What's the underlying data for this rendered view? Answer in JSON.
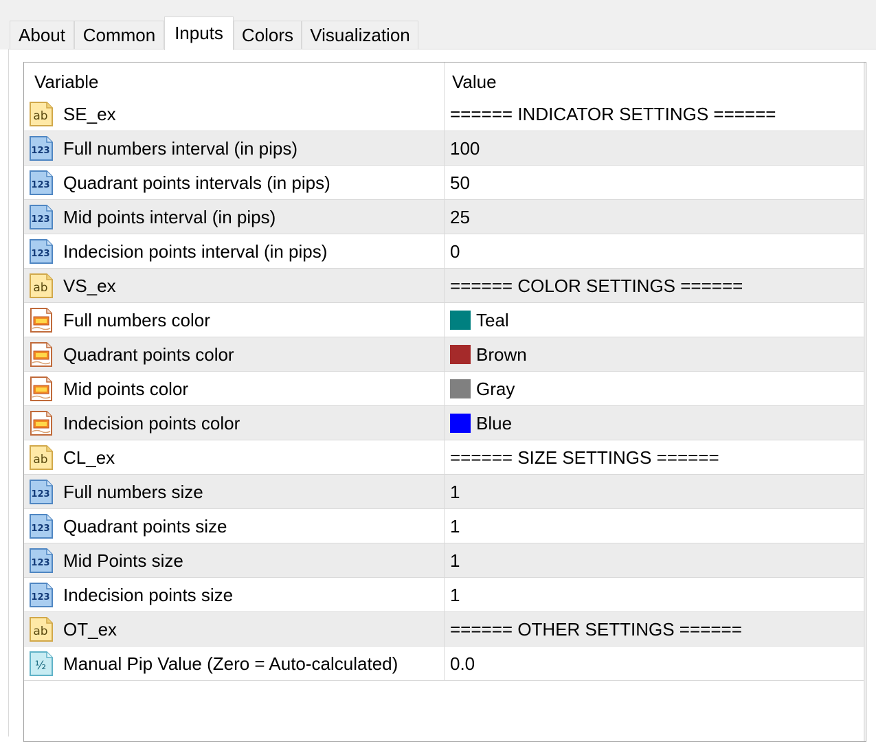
{
  "tabs": [
    {
      "label": "About",
      "active": false
    },
    {
      "label": "Common",
      "active": false
    },
    {
      "label": "Inputs",
      "active": true
    },
    {
      "label": "Colors",
      "active": false
    },
    {
      "label": "Visualization",
      "active": false
    }
  ],
  "table": {
    "columns": [
      "Variable",
      "Value"
    ],
    "rows": [
      {
        "icon": "string-type-icon",
        "variable": "SE_ex",
        "value": "====== INDICATOR SETTINGS ======"
      },
      {
        "icon": "integer-type-icon",
        "variable": "Full numbers interval (in pips)",
        "value": "100"
      },
      {
        "icon": "integer-type-icon",
        "variable": "Quadrant points intervals (in pips)",
        "value": "50"
      },
      {
        "icon": "integer-type-icon",
        "variable": "Mid points interval (in pips)",
        "value": "25"
      },
      {
        "icon": "integer-type-icon",
        "variable": "Indecision points interval (in pips)",
        "value": "0"
      },
      {
        "icon": "string-type-icon",
        "variable": "VS_ex",
        "value": "====== COLOR SETTINGS ======"
      },
      {
        "icon": "color-type-icon",
        "variable": "Full numbers color",
        "value": "Teal",
        "swatch": "#008080"
      },
      {
        "icon": "color-type-icon",
        "variable": "Quadrant points color",
        "value": "Brown",
        "swatch": "#a52a2a"
      },
      {
        "icon": "color-type-icon",
        "variable": "Mid points color",
        "value": "Gray",
        "swatch": "#808080"
      },
      {
        "icon": "color-type-icon",
        "variable": "Indecision points color",
        "value": "Blue",
        "swatch": "#0000ff"
      },
      {
        "icon": "string-type-icon",
        "variable": "CL_ex",
        "value": "====== SIZE SETTINGS ======"
      },
      {
        "icon": "integer-type-icon",
        "variable": "Full numbers size",
        "value": "1"
      },
      {
        "icon": "integer-type-icon",
        "variable": "Quadrant points size",
        "value": "1"
      },
      {
        "icon": "integer-type-icon",
        "variable": "Mid Points size",
        "value": "1"
      },
      {
        "icon": "integer-type-icon",
        "variable": "Indecision points size",
        "value": "1"
      },
      {
        "icon": "string-type-icon",
        "variable": "OT_ex",
        "value": "====== OTHER SETTINGS ======"
      },
      {
        "icon": "double-type-icon",
        "variable": "Manual Pip Value (Zero = Auto-calculated)",
        "value": "0.0"
      }
    ]
  },
  "icon_glyphs": {
    "string-type-icon": "ab",
    "integer-type-icon": "123",
    "double-type-icon": "½"
  },
  "colors": {
    "row_alt_bg": "#ececec",
    "grid_border": "#a0a0a0",
    "tab_bg": "#f0f0f0"
  }
}
